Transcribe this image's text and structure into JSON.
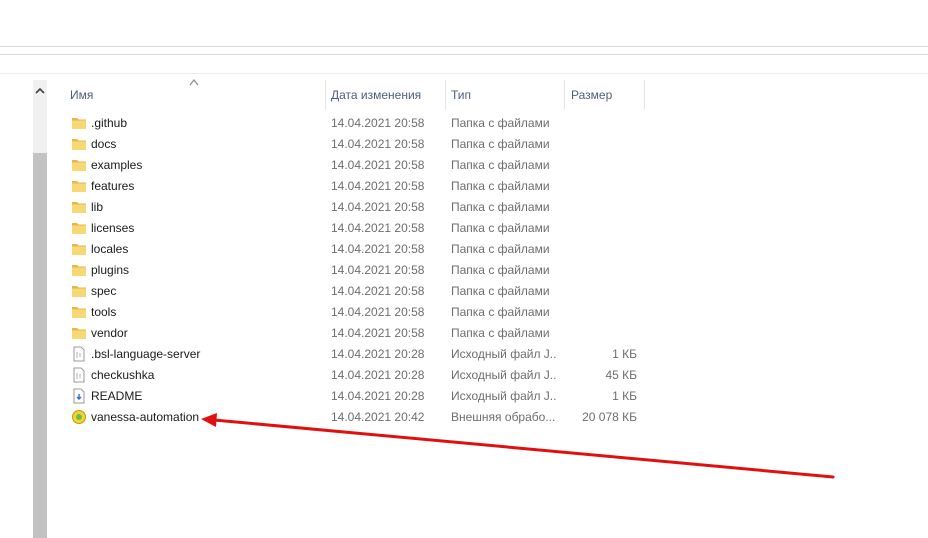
{
  "columns": {
    "name": "Имя",
    "date": "Дата изменения",
    "type": "Тип",
    "size": "Размер"
  },
  "rows": [
    {
      "name": ".github",
      "date": "14.04.2021 20:58",
      "type": "Папка с файлами",
      "size": "",
      "icon": "folder-icon"
    },
    {
      "name": "docs",
      "date": "14.04.2021 20:58",
      "type": "Папка с файлами",
      "size": "",
      "icon": "folder-icon"
    },
    {
      "name": "examples",
      "date": "14.04.2021 20:58",
      "type": "Папка с файлами",
      "size": "",
      "icon": "folder-icon"
    },
    {
      "name": "features",
      "date": "14.04.2021 20:58",
      "type": "Папка с файлами",
      "size": "",
      "icon": "folder-icon"
    },
    {
      "name": "lib",
      "date": "14.04.2021 20:58",
      "type": "Папка с файлами",
      "size": "",
      "icon": "folder-icon"
    },
    {
      "name": "licenses",
      "date": "14.04.2021 20:58",
      "type": "Папка с файлами",
      "size": "",
      "icon": "folder-icon"
    },
    {
      "name": "locales",
      "date": "14.04.2021 20:58",
      "type": "Папка с файлами",
      "size": "",
      "icon": "folder-icon"
    },
    {
      "name": "plugins",
      "date": "14.04.2021 20:58",
      "type": "Папка с файлами",
      "size": "",
      "icon": "folder-icon"
    },
    {
      "name": "spec",
      "date": "14.04.2021 20:58",
      "type": "Папка с файлами",
      "size": "",
      "icon": "folder-icon"
    },
    {
      "name": "tools",
      "date": "14.04.2021 20:58",
      "type": "Папка с файлами",
      "size": "",
      "icon": "folder-icon"
    },
    {
      "name": "vendor",
      "date": "14.04.2021 20:58",
      "type": "Папка с файлами",
      "size": "",
      "icon": "folder-icon"
    },
    {
      "name": ".bsl-language-server",
      "date": "14.04.2021 20:28",
      "type": "Исходный файл J...",
      "size": "1 КБ",
      "icon": "json-file-icon"
    },
    {
      "name": "checkushka",
      "date": "14.04.2021 20:28",
      "type": "Исходный файл J...",
      "size": "45 КБ",
      "icon": "json-file-icon"
    },
    {
      "name": "README",
      "date": "14.04.2021 20:28",
      "type": "Исходный файл J...",
      "size": "1 КБ",
      "icon": "markdown-file-icon"
    },
    {
      "name": "vanessa-automation",
      "date": "14.04.2021 20:42",
      "type": "Внешняя обрабо...",
      "size": "20 078 КБ",
      "icon": "epf-file-icon"
    }
  ],
  "annotation": {
    "type": "red-arrow",
    "color": "#e01010",
    "points_to": "vanessa-automation"
  },
  "colors": {
    "folder": "#f8d775",
    "header_text": "#4c607a",
    "detail_text": "#6d6d6d"
  }
}
